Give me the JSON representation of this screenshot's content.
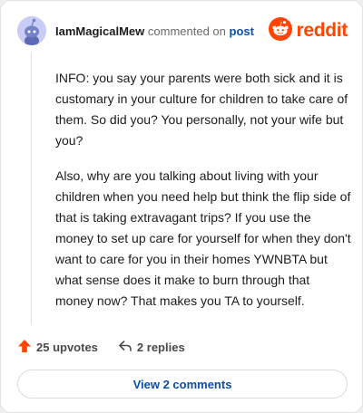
{
  "comment": {
    "username": "IamMagicalMew",
    "action_text": "commented on",
    "post_link": "post",
    "brand": "reddit",
    "paragraphs": [
      "INFO: you say your parents were both sick and it is customary in your culture for children to take care of them. So did you? You personally, not your wife but you?",
      "Also, why are you talking about living with your children when you need help but think the flip side of that is taking extravagant trips? If you use the money to set up care for yourself for when they don't want to care for you in their homes YWNBTA but what sense does it make to burn through that money now? That makes you TA to yourself."
    ],
    "upvotes": "25 upvotes",
    "replies": "2 replies",
    "view_comments": "View 2 comments"
  },
  "colors": {
    "brand": "#ff4500",
    "link": "#0b4fa8",
    "avatar_bg": "#c9ccf5"
  },
  "icons": {
    "avatar": "snoo-avatar-icon",
    "logo": "reddit-snoo-icon",
    "upvote": "upvote-arrow-icon",
    "reply": "reply-arrow-icon"
  }
}
